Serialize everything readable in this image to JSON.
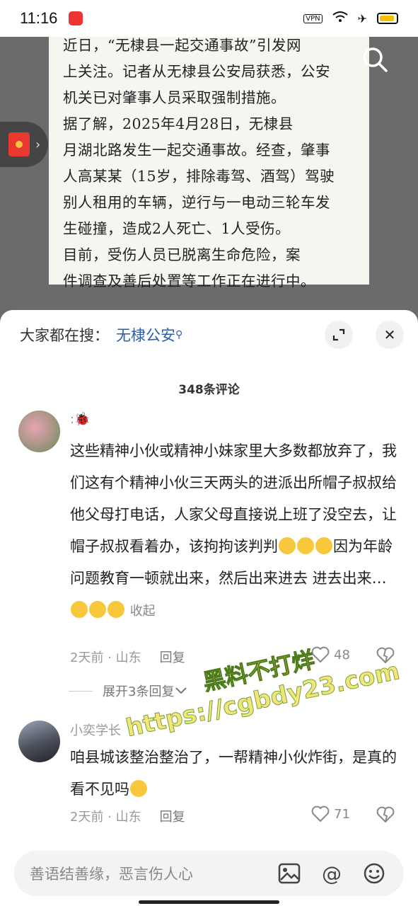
{
  "status": {
    "time": "11:16",
    "net": "VPN"
  },
  "article": {
    "lines": [
      "    近日，“无棣县一起交通事故”引发网",
      "上关注。记者从无棣县公安局获悉，公安",
      "机关已对肇事人员采取强制措施。",
      "    据了解，2025年4月28日，无棣县",
      "月湖北路发生一起交通事故。经查，肇事",
      "人高某某（15岁，排除毒驾、酒驾）驾驶",
      "别人租用的车辆，逆行与一电动三轮车发",
      "生碰撞，造成2人死亡、1人受伤。",
      "    目前，受伤人员已脱离生命危险，案",
      "件调查及善后处置等工作正在进行中。"
    ]
  },
  "sheet": {
    "hot_search_label": "大家都在搜：",
    "hot_search_term": "无棣公安",
    "comment_count": "348条评论"
  },
  "comments": [
    {
      "name": ":🐞",
      "text_a": "这些精神小伙或精神小妹家里大多数都放弃了，我们这有个精神小伙三天两头的进派出所帽子叔叔给他父母打电话，人家父母直接说上班了没空去，让帽子叔叔看着办，该拘拘该判判",
      "text_b": "因为年龄问题教育一顿就出来，然后出来进去 进去出来…",
      "collapse": "收起",
      "time": "2天前 · 山东",
      "reply": "回复",
      "likes": "48",
      "expand": "展开3条回复"
    },
    {
      "name": "小奕学长",
      "text_a": "咱县城该整治整治了，一帮精神小伙炸街，是真的看不见吗",
      "time": "2天前 · 山东",
      "reply": "回复",
      "likes": "71"
    }
  ],
  "watermark": {
    "line1": "黑料不打烊",
    "line2": "https://cgbdy23.com"
  },
  "input": {
    "placeholder": "善语结善缘，恶言伤人心"
  },
  "icons": [
    "search-icon",
    "red-packet-icon",
    "expand-icon",
    "close-icon",
    "heart-icon",
    "dislike-icon",
    "image-icon",
    "at-icon",
    "emoji-icon"
  ]
}
